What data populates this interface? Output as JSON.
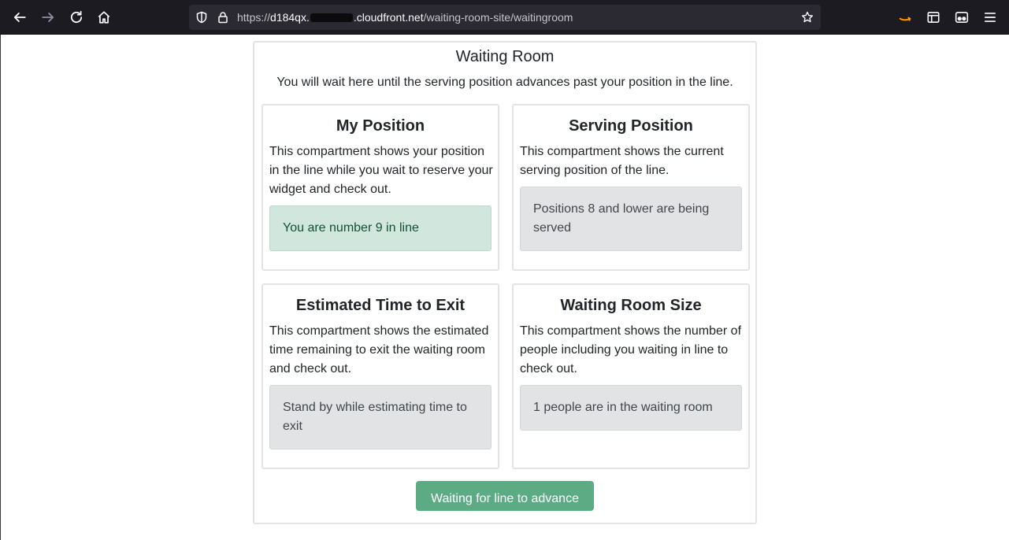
{
  "browser": {
    "url_scheme": "https://",
    "url_host_start": "d184qx.",
    "url_host_end": ".cloudfront.net",
    "url_path": "/waiting-room-site/waitingroom",
    "icons": {
      "back": "back-arrow-icon",
      "forward": "forward-arrow-icon",
      "reload": "reload-icon",
      "home": "home-icon",
      "shield": "shield-icon",
      "lock": "lock-icon",
      "bookmark": "star-icon",
      "amazon": "amazon-extension-icon",
      "reader": "reader-view-icon",
      "privacy": "mask-extension-icon",
      "menu": "hamburger-menu-icon"
    },
    "accent_color": "#ff9900"
  },
  "room": {
    "title": "Waiting Room",
    "description": "You will wait here until the serving position advances past your position in the line."
  },
  "panels": {
    "my_position": {
      "title": "My Position",
      "text": "This compartment shows your position in the line while you wait to reserve your widget and check out.",
      "status": "You are number 9 in line"
    },
    "serving_position": {
      "title": "Serving Position",
      "text": "This compartment shows the current serving position of the line.",
      "status": "Positions 8 and lower are being served"
    },
    "time_to_exit": {
      "title": "Estimated Time to Exit",
      "text": "This compartment shows the estimated time remaining to exit the waiting room and check out.",
      "status": "Stand by while estimating time to exit"
    },
    "room_size": {
      "title": "Waiting Room Size",
      "text": "This compartment shows the number of people including you waiting in line to check out.",
      "status": "1 people are in the waiting room"
    }
  },
  "action": {
    "label": "Waiting for line to advance"
  },
  "colors": {
    "success_bg": "#d1e7dd",
    "success_text": "#0f5132",
    "secondary_bg": "#e2e3e5",
    "button_bg": "#5cab84"
  }
}
